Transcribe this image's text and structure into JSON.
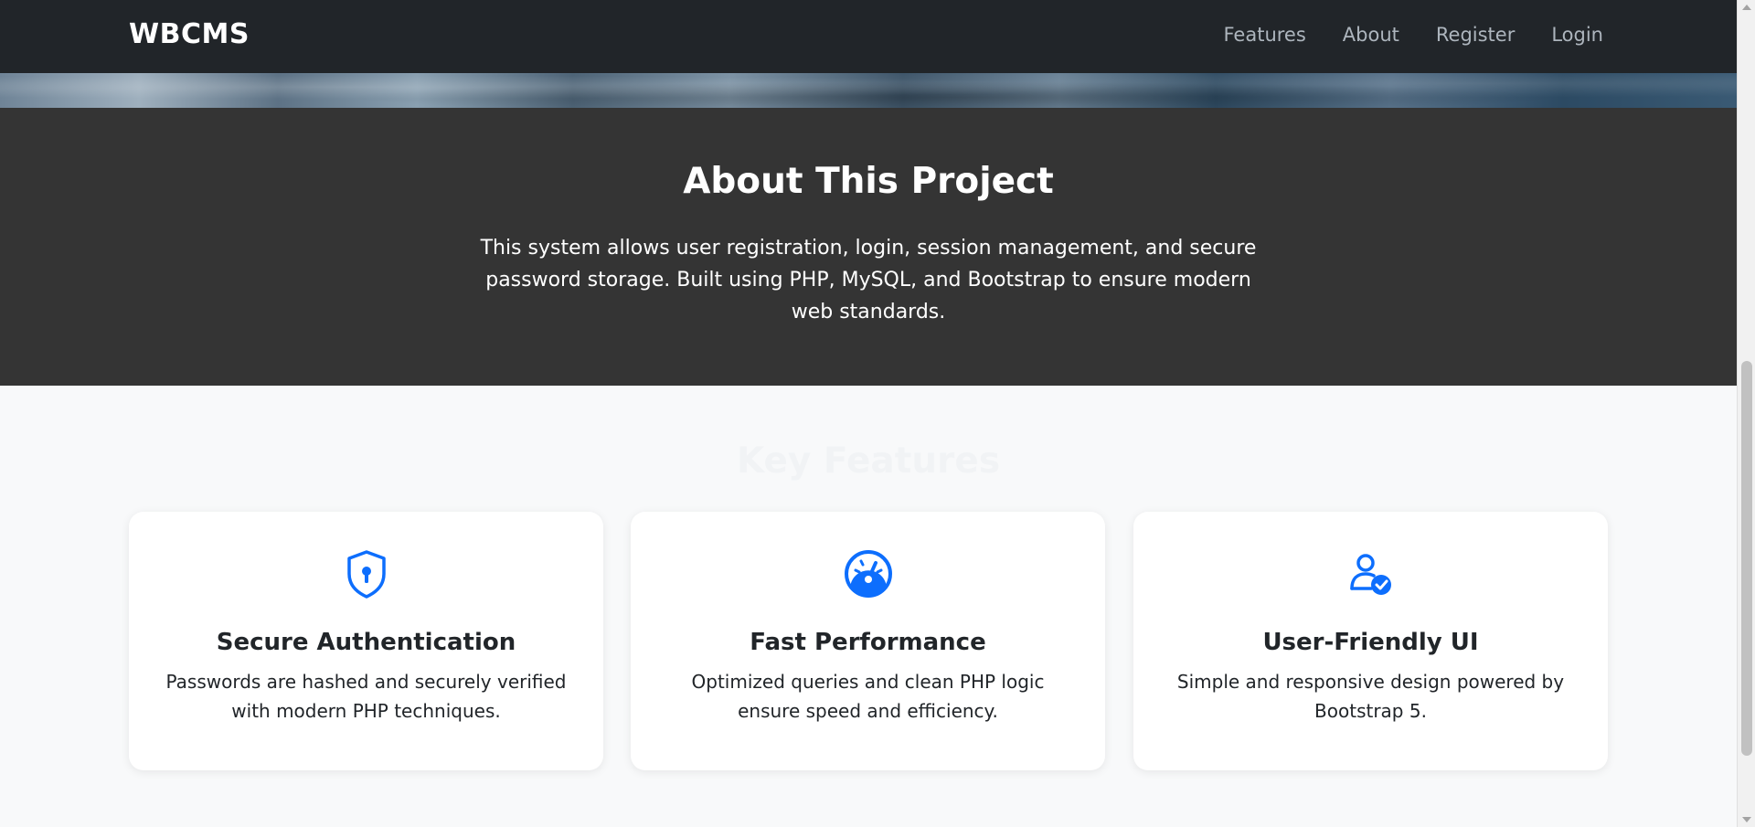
{
  "navbar": {
    "brand": "WBCMS",
    "links": [
      {
        "label": "Features"
      },
      {
        "label": "About"
      },
      {
        "label": "Register"
      },
      {
        "label": "Login"
      }
    ]
  },
  "about": {
    "title": "About This Project",
    "description": "This system allows user registration, login, session management, and secure password storage. Built using PHP, MySQL, and Bootstrap to ensure modern web standards."
  },
  "features": {
    "title": "Key Features",
    "cards": [
      {
        "icon": "shield-lock-icon",
        "title": "Secure Authentication",
        "description": "Passwords are hashed and securely verified with modern PHP techniques."
      },
      {
        "icon": "speedometer-icon",
        "title": "Fast Performance",
        "description": "Optimized queries and clean PHP logic ensure speed and efficiency."
      },
      {
        "icon": "user-check-icon",
        "title": "User-Friendly UI",
        "description": "Simple and responsive design powered by Bootstrap 5."
      }
    ]
  },
  "colors": {
    "navbar_bg": "#212529",
    "about_bg": "#343434",
    "accent": "#0d6efd",
    "features_bg": "#f8f9fa"
  }
}
